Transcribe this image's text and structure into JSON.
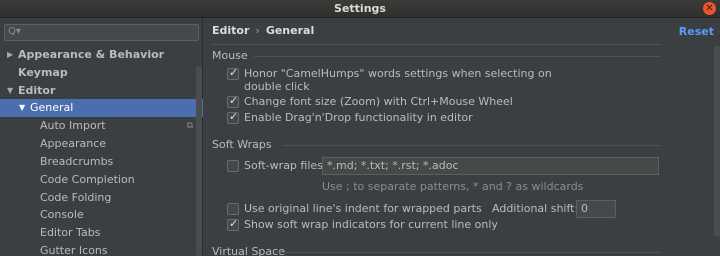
{
  "window": {
    "title": "Settings"
  },
  "sidebar": {
    "search_placeholder": "",
    "items": [
      {
        "label": "Appearance & Behavior",
        "arrow": "▶"
      },
      {
        "label": "Keymap"
      },
      {
        "label": "Editor",
        "arrow": "▼"
      },
      {
        "label": "General",
        "arrow": "▼"
      },
      {
        "label": "Auto Import"
      },
      {
        "label": "Appearance"
      },
      {
        "label": "Breadcrumbs"
      },
      {
        "label": "Code Completion"
      },
      {
        "label": "Code Folding"
      },
      {
        "label": "Console"
      },
      {
        "label": "Editor Tabs"
      },
      {
        "label": "Gutter Icons"
      }
    ]
  },
  "header": {
    "crumb_parent": "Editor",
    "crumb_sep": "›",
    "crumb_current": "General",
    "reset_label": "Reset"
  },
  "mouse": {
    "title": "Mouse",
    "camelhumps_line1": "Honor \"CamelHumps\" words settings when selecting on",
    "camelhumps_line2": "double click",
    "zoom": "Change font size (Zoom) with Ctrl+Mouse Wheel",
    "dragdrop": "Enable Drag'n'Drop functionality in editor"
  },
  "softwraps": {
    "title": "Soft Wraps",
    "files_label": "Soft-wrap files:",
    "files_value": "*.md; *.txt; *.rst; *.adoc",
    "hint": "Use ; to separate patterns, * and ? as wildcards",
    "indent": "Use original line's indent for wrapped parts",
    "shift_label": "Additional shift:",
    "shift_value": "0",
    "indicators": "Show soft wrap indicators for current line only"
  },
  "virtual": {
    "title": "Virtual Space"
  }
}
